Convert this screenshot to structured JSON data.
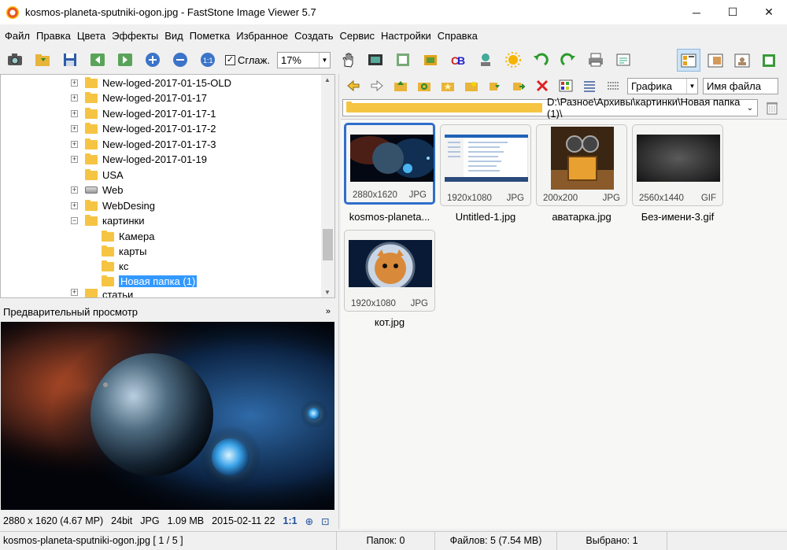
{
  "window": {
    "title": "kosmos-planeta-sputniki-ogon.jpg  -  FastStone Image Viewer 5.7",
    "minimize": "─",
    "maximize": "☐",
    "close": "✕"
  },
  "menu": [
    "Файл",
    "Правка",
    "Цвета",
    "Эффекты",
    "Вид",
    "Пометка",
    "Избранное",
    "Создать",
    "Сервис",
    "Настройки",
    "Справка"
  ],
  "toolbar": {
    "smooth_label": "Сглаж.",
    "smooth_checked": "✓",
    "zoom_value": "17%"
  },
  "tree": {
    "items": [
      {
        "label": "New-loged-2017-01-15-OLD",
        "expander": "+"
      },
      {
        "label": "New-loged-2017-01-17",
        "expander": "+"
      },
      {
        "label": "New-loged-2017-01-17-1",
        "expander": "+"
      },
      {
        "label": "New-loged-2017-01-17-2",
        "expander": "+"
      },
      {
        "label": "New-loged-2017-01-17-3",
        "expander": "+"
      },
      {
        "label": "New-loged-2017-01-19",
        "expander": "+"
      },
      {
        "label": "USA",
        "expander": ""
      },
      {
        "label": "Web",
        "expander": "+"
      },
      {
        "label": "WebDesing",
        "expander": "+"
      },
      {
        "label": "картинки",
        "expander": "−"
      },
      {
        "label": "Камера",
        "expander": ""
      },
      {
        "label": "карты",
        "expander": ""
      },
      {
        "label": "кс",
        "expander": ""
      },
      {
        "label": "Новая папка (1)",
        "expander": ""
      },
      {
        "label": "статьи",
        "expander": "+"
      }
    ]
  },
  "preview": {
    "header": "Предварительный просмотр",
    "collapse": "»"
  },
  "info": {
    "dimensions": "2880 x 1620 (4.67 MP)",
    "bits": "24bit",
    "format": "JPG",
    "size": "1.09 MB",
    "date": "2015-02-11 22",
    "ratio": "1:1"
  },
  "browser": {
    "sort_filter": "Графика",
    "sort_by": "Имя файла",
    "path": "D:\\Разное\\Архивы\\картинки\\Новая папка (1)\\",
    "files": [
      {
        "name": "kosmos-planeta...",
        "res": "2880x1620",
        "type": "JPG"
      },
      {
        "name": "Untitled-1.jpg",
        "res": "1920x1080",
        "type": "JPG"
      },
      {
        "name": "аватарка.jpg",
        "res": "200x200",
        "type": "JPG"
      },
      {
        "name": "Без-имени-3.gif",
        "res": "2560x1440",
        "type": "GIF"
      },
      {
        "name": "кот.jpg",
        "res": "1920x1080",
        "type": "JPG"
      }
    ]
  },
  "status": {
    "file": "kosmos-planeta-sputniki-ogon.jpg [ 1 / 5 ]",
    "folders": "Папок: 0",
    "files": "Файлов: 5 (7.54 MB)",
    "selected": "Выбрано: 1"
  }
}
